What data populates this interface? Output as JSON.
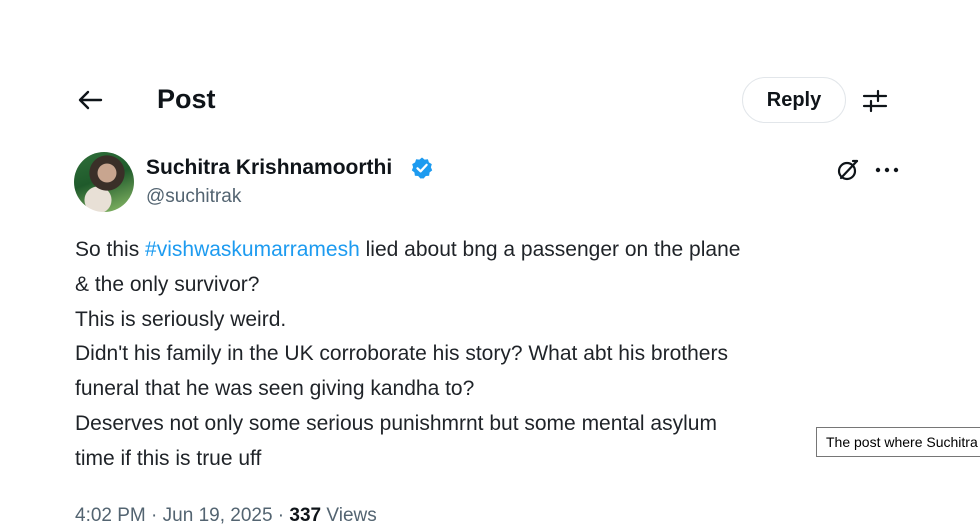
{
  "header": {
    "title": "Post",
    "reply_label": "Reply"
  },
  "post": {
    "author_name": "Suchitra Krishnamoorthi",
    "author_handle": "@suchitrak",
    "body": {
      "line1_prefix": "So this ",
      "hashtag": "#vishwaskumarramesh",
      "line1_suffix": " lied about bng a passenger on the plane",
      "line2": "& the only survivor?",
      "line3": "This is seriously weird.",
      "line4": "Didn't his family in the UK corroborate his story? What abt his brothers",
      "line5": "funeral that he was seen giving kandha to?",
      "line6": "Deserves not only some serious punishmrnt but some mental asylum",
      "line7": "time if this is true uff"
    },
    "time": "4:02 PM",
    "date": "Jun 19, 2025",
    "separator": " · ",
    "views_count": "337",
    "views_label": "Views"
  },
  "tooltip": {
    "text": "The post where Suchitra"
  },
  "colors": {
    "accent": "#1d9bf0",
    "text": "#0f1419",
    "muted": "#536471"
  },
  "icons": [
    "back-arrow-icon",
    "settings-sliders-icon",
    "verified-badge-icon",
    "grok-icon",
    "more-icon"
  ]
}
